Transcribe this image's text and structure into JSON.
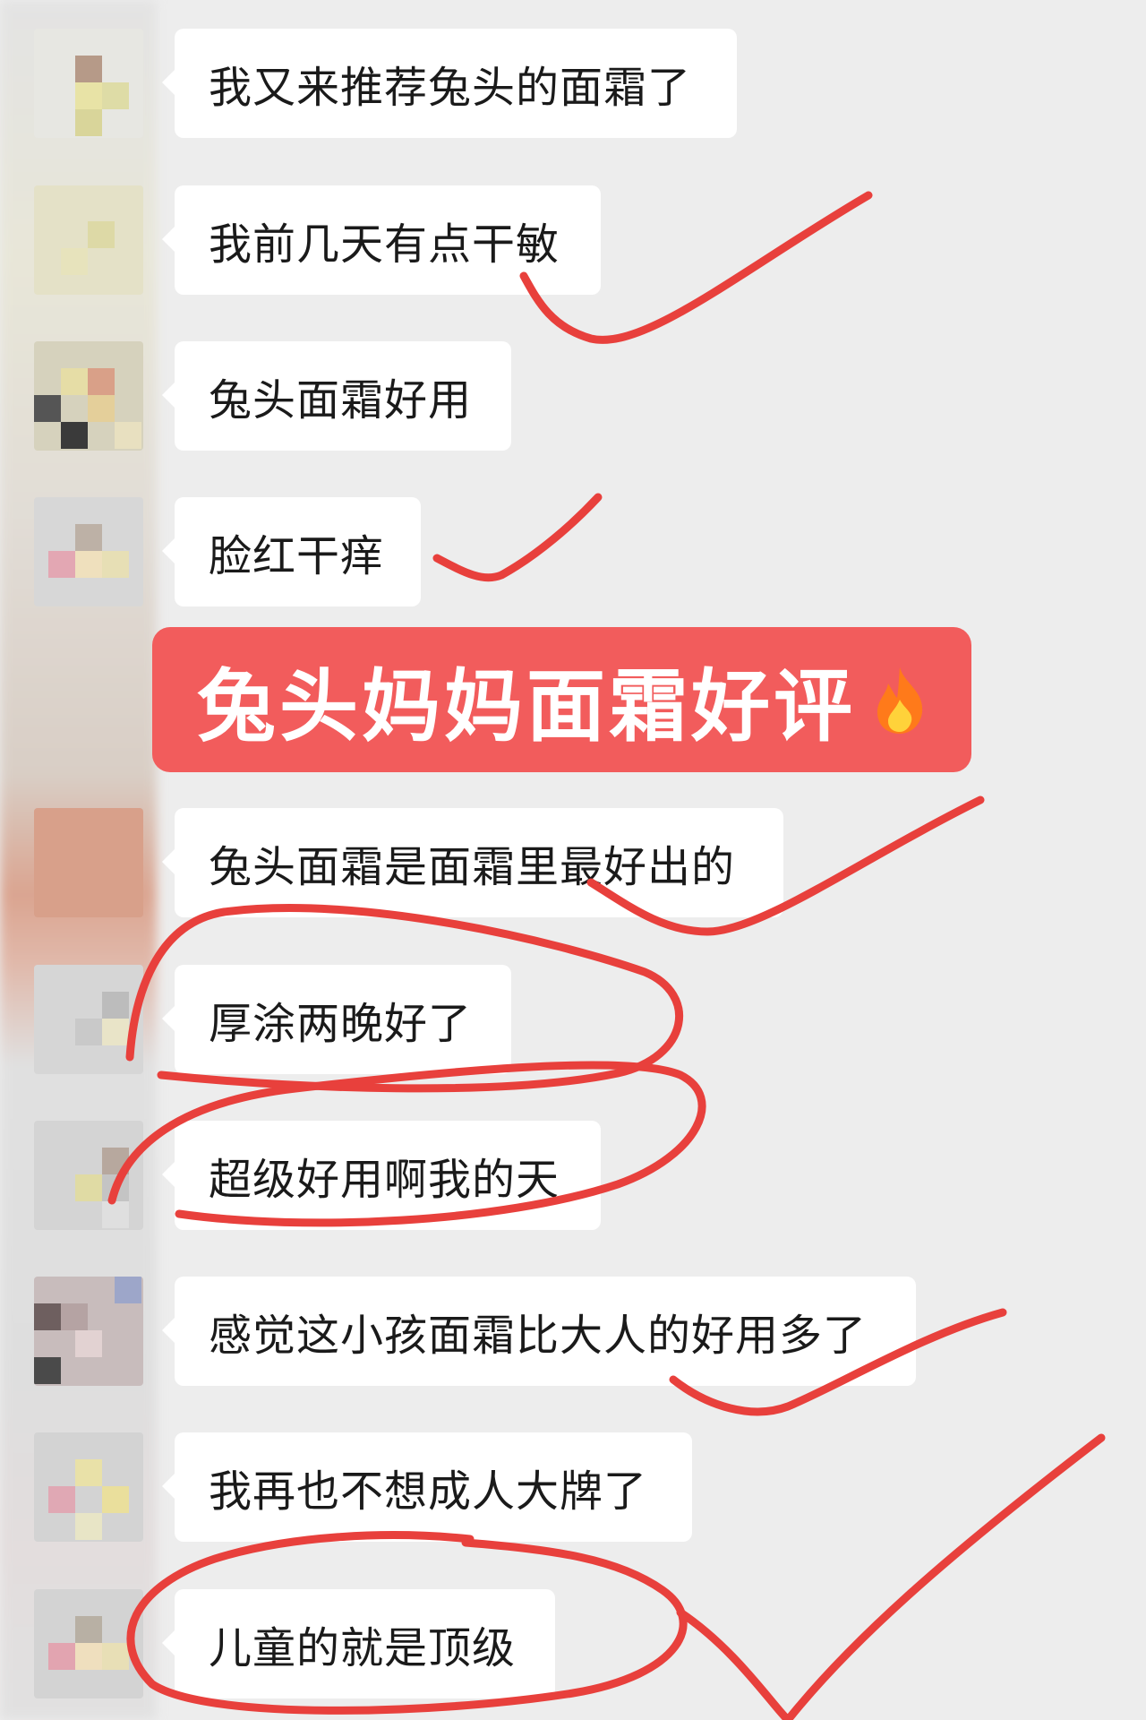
{
  "banner": {
    "title": "兔头妈妈面霜好评",
    "icon": "fire-icon"
  },
  "messages": [
    {
      "text": "我又来推荐兔头的面霜了"
    },
    {
      "text": "我前几天有点干敏"
    },
    {
      "text": "兔头面霜好用"
    },
    {
      "text": "脸红干痒"
    },
    {
      "text": "兔头面霜是面霜里最好出的"
    },
    {
      "text": "厚涂两晚好了"
    },
    {
      "text": "超级好用啊我的天"
    },
    {
      "text": "感觉这小孩面霜比大人的好用多了"
    },
    {
      "text": "我再也不想成人大牌了"
    },
    {
      "text": "儿童的就是顶级"
    }
  ],
  "colors": {
    "background": "#ededed",
    "bubble": "#ffffff",
    "banner": "#f25c5c",
    "annotation": "#e8403c"
  }
}
